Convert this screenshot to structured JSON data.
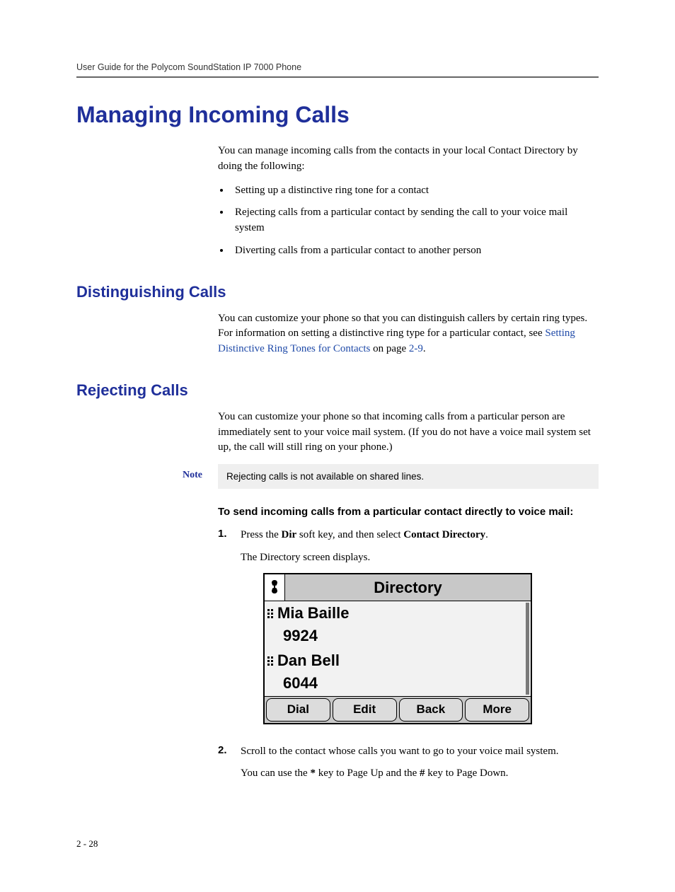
{
  "running_head": "User Guide for the Polycom SoundStation IP 7000 Phone",
  "title": "Managing Incoming Calls",
  "intro": "You can manage incoming calls from the contacts in your local Contact Directory by doing the following:",
  "bullets": [
    "Setting up a distinctive ring tone for a contact",
    "Rejecting calls from a particular contact by sending the call to your voice mail system",
    "Diverting calls from a particular contact to another person"
  ],
  "section1": {
    "heading": "Distinguishing Calls",
    "para_pre": "You can customize your phone so that you can distinguish callers by certain ring types. For information on setting a distinctive ring type for a particular contact, see ",
    "link_text": "Setting Distinctive Ring Tones for Contacts",
    "para_mid": " on page ",
    "page_ref": "2-9",
    "para_post": "."
  },
  "section2": {
    "heading": "Rejecting Calls",
    "para": "You can customize your phone so that incoming calls from a particular person are immediately sent to your voice mail system. (If you do not have a voice mail system set up, the call will still ring on your phone.)"
  },
  "note": {
    "label": "Note",
    "text": "Rejecting calls is not available on shared lines."
  },
  "procedure": {
    "title": "To send incoming calls from a particular contact directly to voice mail:",
    "steps": [
      {
        "num": "1.",
        "pre": "Press the ",
        "b1": "Dir",
        "mid": " soft key, and then select ",
        "b2": "Contact Directory",
        "post": ".",
        "after": "The Directory screen displays."
      },
      {
        "num": "2.",
        "line1": "Scroll to the contact whose calls you want to go to your voice mail system.",
        "line2_pre": "You can use the ",
        "line2_b1": "*",
        "line2_mid": " key to Page Up and the ",
        "line2_b2": "#",
        "line2_post": " key to Page Down."
      }
    ]
  },
  "screen": {
    "title": "Directory",
    "entries": [
      {
        "name": "Mia Baille",
        "number": "9924"
      },
      {
        "name": "Dan Bell",
        "number": "6044"
      }
    ],
    "softkeys": [
      "Dial",
      "Edit",
      "Back",
      "More"
    ]
  },
  "page_number": "2 - 28"
}
